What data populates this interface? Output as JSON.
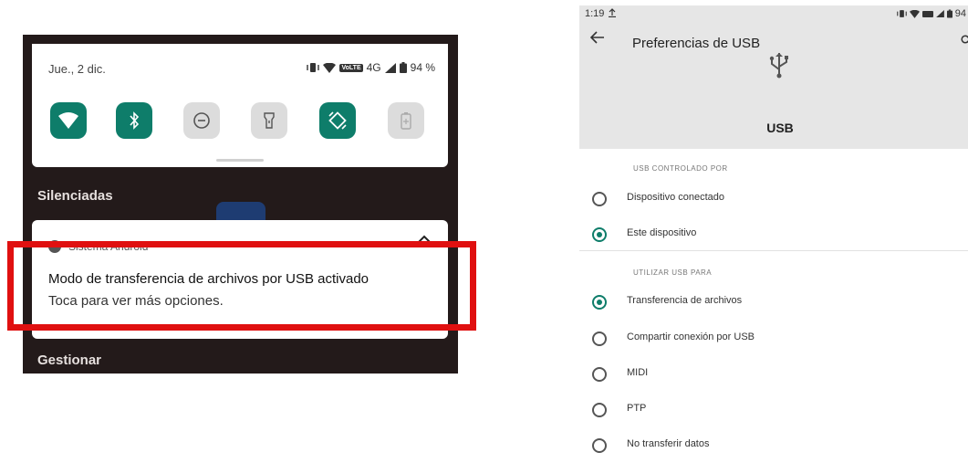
{
  "notification_shade": {
    "date": "Jue., 2 dic.",
    "status_volte": "VoLTE",
    "status_network": "4G",
    "battery": "94 %",
    "tiles": [
      {
        "icon": "wifi-icon",
        "active": true
      },
      {
        "icon": "bluetooth-icon",
        "active": true
      },
      {
        "icon": "do-not-disturb-icon",
        "active": false
      },
      {
        "icon": "flashlight-icon",
        "active": false
      },
      {
        "icon": "auto-rotate-icon",
        "active": true
      },
      {
        "icon": "battery-saver-icon",
        "active": false
      }
    ],
    "section_silenced": "Silenciadas",
    "notification": {
      "app_name": "Sistema Android",
      "title": "Modo de transferencia de archivos por USB activado",
      "text": "Toca para ver más opciones."
    },
    "manage_label": "Gestionar",
    "highlight_color": "#e01010"
  },
  "usb_settings": {
    "status_time": "1:19",
    "status_battery": "94",
    "title": "Preferencias de USB",
    "header_label": "USB",
    "controlled_by": {
      "heading": "USB CONTROLADO POR",
      "options": [
        {
          "label": "Dispositivo conectado",
          "selected": false
        },
        {
          "label": "Este dispositivo",
          "selected": true
        }
      ]
    },
    "use_for": {
      "heading": "UTILIZAR USB PARA",
      "options": [
        {
          "label": "Transferencia de archivos",
          "selected": true
        },
        {
          "label": "Compartir conexión por USB",
          "selected": false
        },
        {
          "label": "MIDI",
          "selected": false
        },
        {
          "label": "PTP",
          "selected": false
        },
        {
          "label": "No transferir datos",
          "selected": false
        }
      ]
    },
    "accent_color": "#0e7d6a"
  }
}
